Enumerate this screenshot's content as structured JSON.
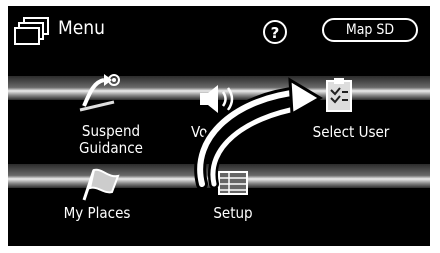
{
  "header": {
    "title": "Menu",
    "help_label": "?",
    "map_sd_label": "Map SD"
  },
  "items": {
    "suspend_guidance": "Suspend\nGuidance",
    "volume": "Vo",
    "select_user": "Select User",
    "my_places": "My Places",
    "setup": "Setup"
  },
  "icons": {
    "menu": "menu-windows-icon",
    "suspend": "suspend-guidance-icon",
    "volume": "speaker-icon",
    "select_user": "clipboard-icon",
    "my_places": "flag-icon",
    "setup": "setup-icon",
    "gesture": "curved-arrow-icon"
  }
}
